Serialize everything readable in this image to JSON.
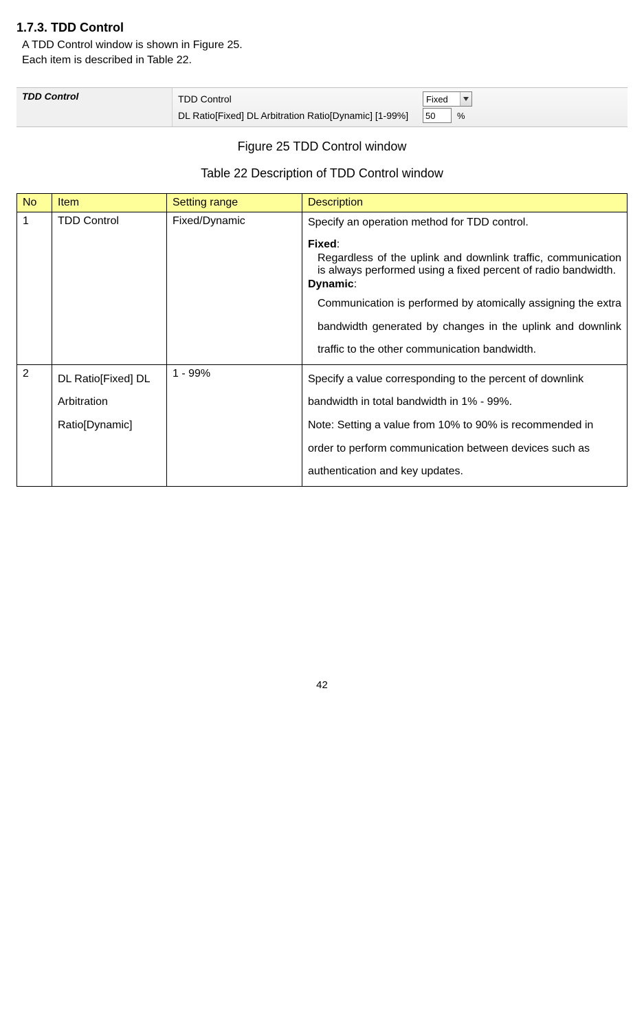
{
  "heading": "1.7.3. TDD Control",
  "intro_line1": "A TDD Control window is shown in Figure 25.",
  "intro_line2": "Each item is described in Table 22.",
  "window": {
    "section_title": "TDD Control",
    "row1_label": "TDD Control",
    "row1_value": "Fixed",
    "row2_label": "DL Ratio[Fixed] DL Arbitration Ratio[Dynamic] [1-99%]",
    "row2_value": "50",
    "row2_unit": "%"
  },
  "figure_caption": "Figure 25 TDD Control window",
  "table_caption": "Table 22 Description of TDD Control window",
  "table": {
    "headers": {
      "no": "No",
      "item": "Item",
      "range": "Setting range",
      "desc": "Description"
    },
    "rows": [
      {
        "no": "1",
        "item": "TDD Control",
        "range": "Fixed/Dynamic",
        "desc_lead": "Specify an operation method for TDD control.",
        "fixed_label": "Fixed",
        "fixed_text": "Regardless of the uplink and downlink traffic, communication is always performed using a fixed percent of radio bandwidth.",
        "dynamic_label": "Dynamic",
        "dynamic_text": "Communication is performed by atomically assigning the extra bandwidth generated by changes in the uplink and downlink traffic to the other communication bandwidth."
      },
      {
        "no": "2",
        "item": "DL Ratio[Fixed] DL Arbitration Ratio[Dynamic]",
        "range": "  1 - 99%",
        "desc_main": "Specify a value corresponding to the percent of downlink bandwidth in total bandwidth in 1% - 99%.",
        "desc_note": "Note: Setting a value from 10% to 90% is recommended in order to perform communication between devices such as authentication and key updates."
      }
    ]
  },
  "page_number": "42"
}
